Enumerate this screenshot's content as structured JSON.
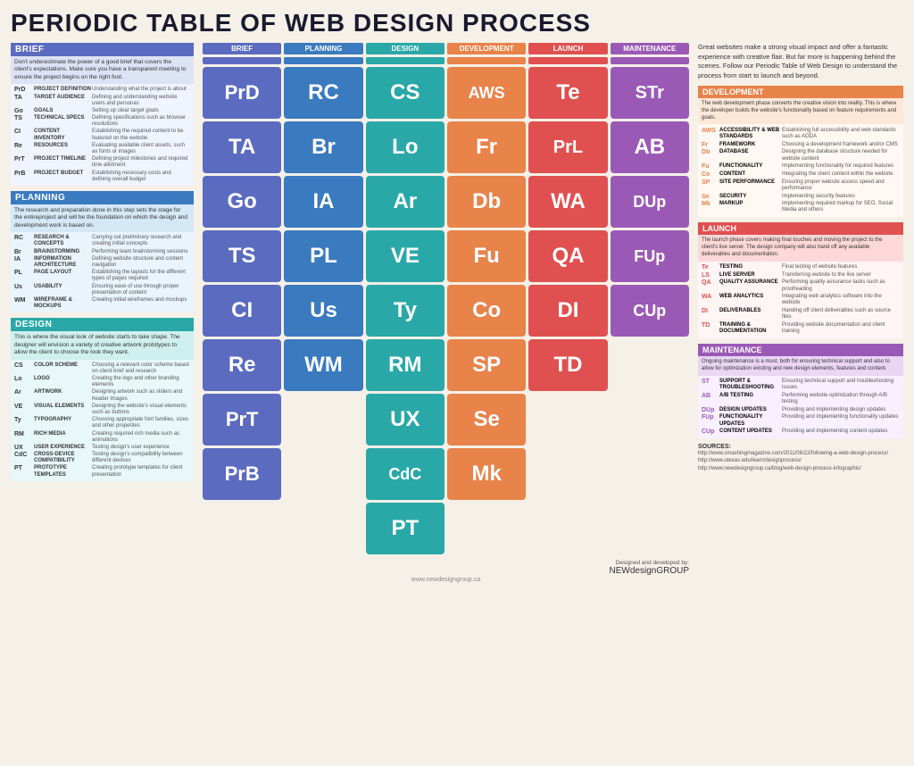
{
  "title": "PERIODIC TABLE OF WEB DESIGN PROCESS",
  "intro": "Great websites make a strong visual impact and offer a fantastic experience with creative flair. But far more is happening behind the scenes. Follow our Periodic Table of Web Design to understand the process from start to launch and beyond.",
  "sections": {
    "brief": {
      "title": "BRIEF",
      "color": "#5b6bbf",
      "desc": "Don't underestimate the power of a good brief that covers the client's expectations. Make sure you have a transparent meeting to ensure the project begins on the right foot.",
      "items": [
        {
          "code": "PrD",
          "name": "PROJECT DEFINITION",
          "desc": "Understanding what the project is about"
        },
        {
          "code": "TA",
          "name": "TARGET AUDIENCE",
          "desc": "Defining and understanding website users and personas"
        },
        {
          "code": "Go",
          "name": "GOALS",
          "desc": "Setting up clear target goals"
        },
        {
          "code": "TS",
          "name": "TECHNICAL SPECS",
          "desc": "Defining specifications such as browser resolutions"
        },
        {
          "code": "CI",
          "name": "CONTENT INVENTORY",
          "desc": "Establishing the required content to be featured on the website"
        },
        {
          "code": "Re",
          "name": "RESOURCES",
          "desc": "Evaluating available client assets, such as fonts or images"
        },
        {
          "code": "PrT",
          "name": "PROJECT TIMELINE",
          "desc": "Defining project milestones and required time allotment"
        },
        {
          "code": "PrB",
          "name": "PROJECT BUDGET",
          "desc": "Establishing necessary costs and defining overall budget"
        }
      ]
    },
    "planning": {
      "title": "PLANNING",
      "color": "#3a7abf",
      "desc": "The research and preparation done in this step sets the stage for the entireproject and will be the foundation on which the design and development work is based on.",
      "items": [
        {
          "code": "RC",
          "name": "RESEARCH & CONCEPTS",
          "desc": "Carrying out preliminary research and creating initial concepts"
        },
        {
          "code": "Br",
          "name": "BRAINSTORMING",
          "desc": "Performing team brainstorming sessions"
        },
        {
          "code": "IA",
          "name": "INFORMATION ARCHITECTURE",
          "desc": "Defining website structure and content navigation"
        },
        {
          "code": "PL",
          "name": "PAGE LAYOUT",
          "desc": "Establishing the layouts for the different types of pages required"
        },
        {
          "code": "Us",
          "name": "USABILITY",
          "desc": "Ensuring ease of use through proper presentation of content"
        },
        {
          "code": "WM",
          "name": "WIREFRAME & MOCKUPS",
          "desc": "Creating initial wireframes and mockups"
        }
      ]
    },
    "design": {
      "title": "DESIGN",
      "color": "#2aa8a8",
      "desc": "This is where the visual look of website starts to take shape. The designer will envision a variety of creative artwork prototypes to allow the client to choose the look they want.",
      "items": [
        {
          "code": "CS",
          "name": "COLOR SCHEME",
          "desc": "Choosing a relevant color scheme based on client brief and research"
        },
        {
          "code": "Lo",
          "name": "LOGO",
          "desc": "Creating the logo and other branding elements"
        },
        {
          "code": "Ar",
          "name": "ARTWORK",
          "desc": "Designing artwork such as sliders and header images"
        },
        {
          "code": "VE",
          "name": "VISUAL ELEMENTS",
          "desc": "Designing the website's visual elements such as buttons"
        },
        {
          "code": "Ty",
          "name": "TYPOGRAPHY",
          "desc": "Choosing appropriate font families, sizes and other properties"
        },
        {
          "code": "RM",
          "name": "RICH MEDIA",
          "desc": "Creating required rich media such as animations"
        },
        {
          "code": "UX",
          "name": "USER EXPERIENCE",
          "desc": "Testing design's user experience"
        },
        {
          "code": "CdC",
          "name": "CROSS-DEVICE COMPATIBILITY",
          "desc": "Testing design's compatibility between different devices"
        },
        {
          "code": "PT",
          "name": "PROTOTYPE TEMPLATES",
          "desc": "Creating prototype templates for client presentation"
        }
      ]
    }
  },
  "right_sections": {
    "development": {
      "title": "DEVELOPMENT",
      "color": "#e8834a",
      "desc": "The web development phase converts the creative vision into reality. This is where the developer builds the website's functionality based on feature requirements and goals.",
      "items": [
        {
          "code": "AWS",
          "name": "ACCESSIBILITY & WEB STANDARDS",
          "desc": "Establishing full accessibility and web standards such as AODA"
        },
        {
          "code": "Fr",
          "name": "FRAMEWORK",
          "desc": "Choosing a development framework and/or CMS"
        },
        {
          "code": "Db",
          "name": "DATABASE",
          "desc": "Designing the database structure needed for website content"
        },
        {
          "code": "Fu",
          "name": "FUNCTIONALITY",
          "desc": "Implementing functionality for required features"
        },
        {
          "code": "Co",
          "name": "CONTENT",
          "desc": "Integrating the client content within the website"
        },
        {
          "code": "SP",
          "name": "SITE PERFORMANCE",
          "desc": "Ensuring proper website access speed and performance"
        },
        {
          "code": "Se",
          "name": "SECURITY",
          "desc": "Implementing security features"
        },
        {
          "code": "Mk",
          "name": "MARKUP",
          "desc": "Implementing required markup for SEO, Social Media and others"
        }
      ]
    },
    "launch": {
      "title": "LAUNCH",
      "color": "#e05050",
      "desc": "The launch phase covers making final touches and moving the project to the client's live server. The design company will also hand off any available deliverables and documentation.",
      "items": [
        {
          "code": "Te",
          "name": "TESTING",
          "desc": "Final testing of website features"
        },
        {
          "code": "LS",
          "name": "LIVE SERVER",
          "desc": "Transferring website to the live server"
        },
        {
          "code": "QA",
          "name": "QUALITY ASSURANCE",
          "desc": "Performing quality assurance tasks such as proofreading"
        },
        {
          "code": "WA",
          "name": "WEB ANALYTICS",
          "desc": "Integrating web analytics software into the website"
        },
        {
          "code": "DI",
          "name": "DELIVERABLES",
          "desc": "Handing off client deliverables such as source files"
        },
        {
          "code": "TD",
          "name": "TRAINING & DOCUMENTATION",
          "desc": "Providing website documentation and client training"
        }
      ]
    },
    "maintenance": {
      "title": "MAINTENANCE",
      "color": "#9b59b6",
      "desc": "Ongoing maintenance is a must, both for ensuring technical support and also to allow for optimization existing and new design elements, features and content.",
      "items": [
        {
          "code": "ST",
          "name": "SUPPORT & TROUBLESHOOTING",
          "desc": "Ensuring technical support and troubleshooting issues"
        },
        {
          "code": "AB",
          "name": "A/B TESTING",
          "desc": "Performing website optimization through A/B testing"
        },
        {
          "code": "DUp",
          "name": "DESIGN UPDATES",
          "desc": "Providing and implementing design updates"
        },
        {
          "code": "FUp",
          "name": "FUNCTIONALITY UPDATES",
          "desc": "Providing and implementing functionality updates"
        },
        {
          "code": "CUp",
          "name": "CONTENT UPDATES",
          "desc": "Providing and implementing content updates"
        }
      ]
    }
  },
  "grid_headers": [
    "BRIEF",
    "PLANNING",
    "DESIGN",
    "DEVELOPMENT",
    "LAUNCH",
    "MAINTENANCE"
  ],
  "grid_rows": [
    [
      {
        "text": "PrD",
        "class": "c-brief"
      },
      {
        "text": "RC",
        "class": "c-planning"
      },
      {
        "text": "CS",
        "class": "c-design"
      },
      {
        "text": "AWS",
        "class": "c-dev",
        "small": true
      },
      {
        "text": "Te",
        "class": "c-launch"
      },
      {
        "text": "STr",
        "class": "c-maint",
        "small": true
      }
    ],
    [
      {
        "text": "TA",
        "class": "c-brief"
      },
      {
        "text": "Br",
        "class": "c-planning"
      },
      {
        "text": "Lo",
        "class": "c-design"
      },
      {
        "text": "Fr",
        "class": "c-dev"
      },
      {
        "text": "PrL",
        "class": "c-launch",
        "small": true
      },
      {
        "text": "AB",
        "class": "c-maint"
      }
    ],
    [
      {
        "text": "Go",
        "class": "c-brief"
      },
      {
        "text": "IA",
        "class": "c-planning"
      },
      {
        "text": "Ar",
        "class": "c-design"
      },
      {
        "text": "Db",
        "class": "c-dev"
      },
      {
        "text": "WA",
        "class": "c-launch"
      },
      {
        "text": "DUp",
        "class": "c-maint",
        "small": true
      }
    ],
    [
      {
        "text": "TS",
        "class": "c-brief"
      },
      {
        "text": "PL",
        "class": "c-planning"
      },
      {
        "text": "VE",
        "class": "c-design"
      },
      {
        "text": "Fu",
        "class": "c-dev"
      },
      {
        "text": "QA",
        "class": "c-launch"
      },
      {
        "text": "FUp",
        "class": "c-maint",
        "small": true
      }
    ],
    [
      {
        "text": "CI",
        "class": "c-brief"
      },
      {
        "text": "Us",
        "class": "c-planning"
      },
      {
        "text": "Ty",
        "class": "c-design"
      },
      {
        "text": "Co",
        "class": "c-dev"
      },
      {
        "text": "DI",
        "class": "c-launch"
      },
      {
        "text": "CUp",
        "class": "c-maint",
        "small": true
      }
    ],
    [
      {
        "text": "Re",
        "class": "c-brief"
      },
      {
        "text": "WM",
        "class": "c-planning"
      },
      {
        "text": "RM",
        "class": "c-design"
      },
      {
        "text": "SP",
        "class": "c-dev"
      },
      {
        "text": "TD",
        "class": "c-launch"
      },
      {
        "text": "",
        "class": "empty"
      }
    ],
    [
      {
        "text": "PrT",
        "class": "c-brief"
      },
      {
        "text": "",
        "class": "empty"
      },
      {
        "text": "UX",
        "class": "c-design"
      },
      {
        "text": "Se",
        "class": "c-dev"
      },
      {
        "text": "",
        "class": "empty"
      },
      {
        "text": "",
        "class": "empty"
      }
    ],
    [
      {
        "text": "PrB",
        "class": "c-brief"
      },
      {
        "text": "",
        "class": "empty"
      },
      {
        "text": "CdC",
        "class": "c-design",
        "small": true
      },
      {
        "text": "Mk",
        "class": "c-dev"
      },
      {
        "text": "",
        "class": "empty"
      },
      {
        "text": "",
        "class": "empty"
      }
    ],
    [
      {
        "text": "",
        "class": "empty"
      },
      {
        "text": "",
        "class": "empty"
      },
      {
        "text": "PT",
        "class": "c-design"
      },
      {
        "text": "",
        "class": "empty"
      },
      {
        "text": "",
        "class": "empty"
      },
      {
        "text": "",
        "class": "empty"
      }
    ]
  ],
  "sources": {
    "title": "SOURCES:",
    "links": [
      "http://www.smashingmagazine.com/2011/06/22/following-a-web-design-process/",
      "http://www.utexas.edu/learn/designprocess/",
      "http://www.newdesigngroup.ca/blog/web-design-process-infographic/"
    ]
  },
  "logo": {
    "designed_by": "Designed and developed by:",
    "company": "NEW design GROUP",
    "website": "www.newdesigngroup.ca"
  }
}
